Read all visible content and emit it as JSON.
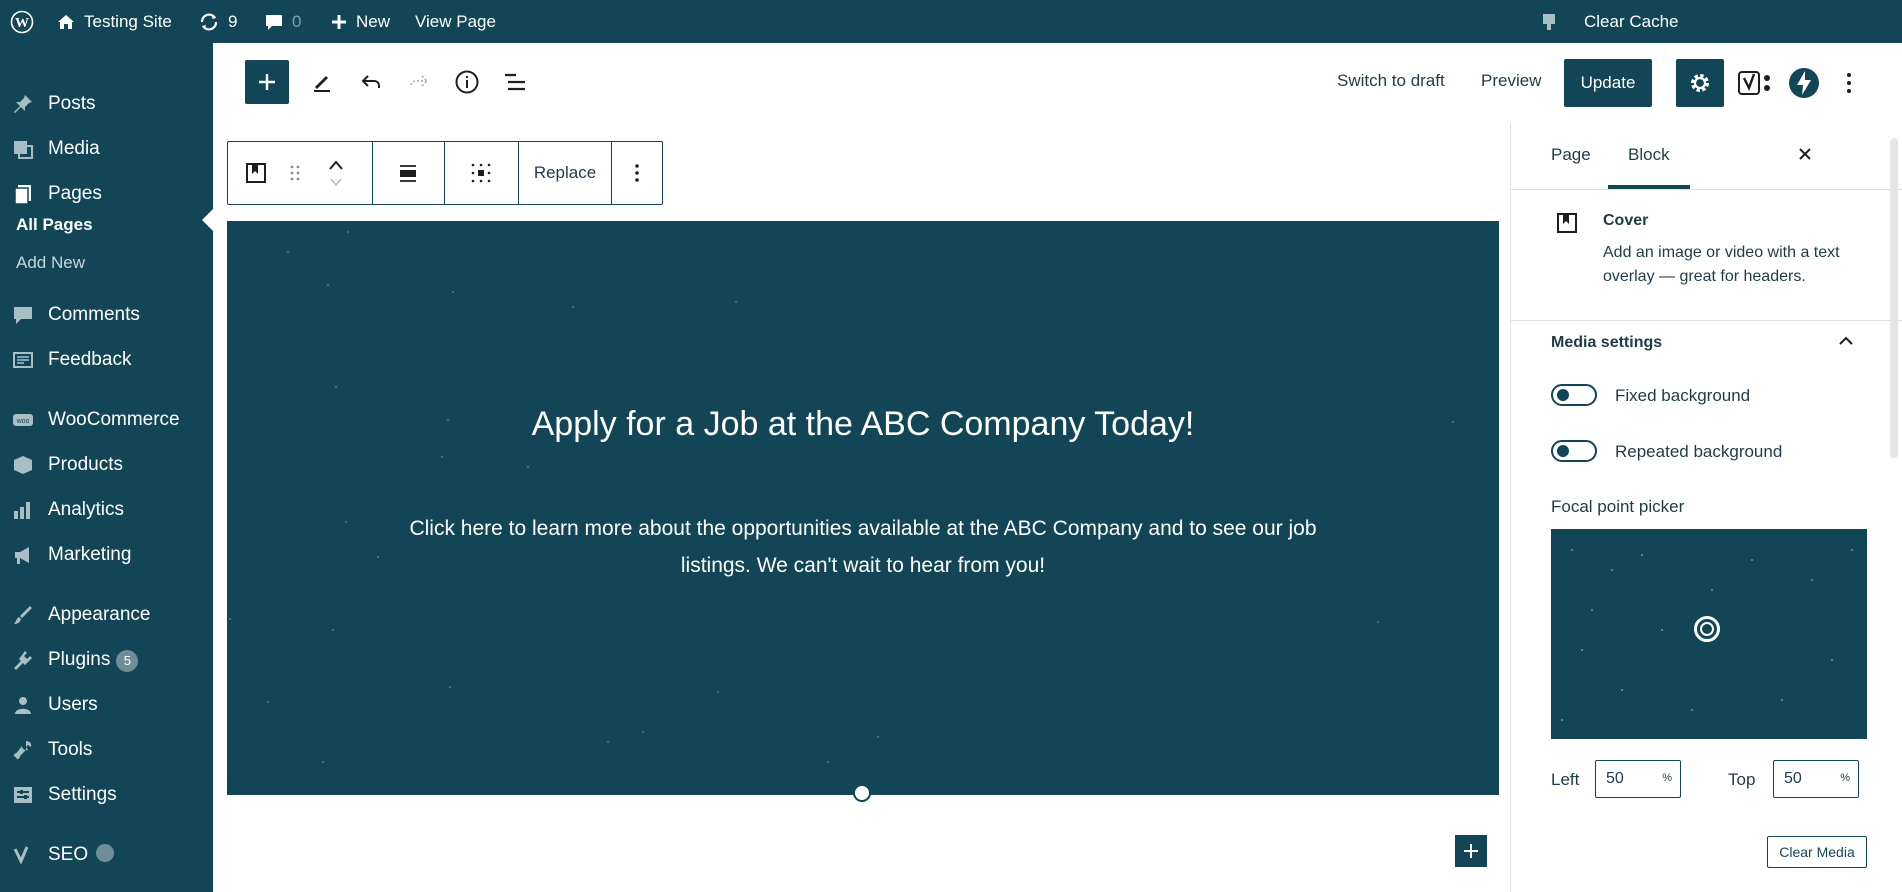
{
  "adminbar": {
    "site_name": "Testing Site",
    "updates_count": "9",
    "comments_count": "0",
    "new_label": "New",
    "view_page_label": "View Page",
    "clear_cache_label": "Clear Cache"
  },
  "menu": {
    "items": [
      {
        "label": "Posts",
        "icon": "pushpin-icon"
      },
      {
        "label": "Media",
        "icon": "media-icon"
      },
      {
        "label": "Pages",
        "icon": "pages-icon"
      },
      {
        "label": "Comments",
        "icon": "comment-icon"
      },
      {
        "label": "Feedback",
        "icon": "feedback-icon"
      },
      {
        "label": "WooCommerce",
        "icon": "woocommerce-icon"
      },
      {
        "label": "Products",
        "icon": "products-icon"
      },
      {
        "label": "Analytics",
        "icon": "analytics-icon"
      },
      {
        "label": "Marketing",
        "icon": "megaphone-icon"
      },
      {
        "label": "Appearance",
        "icon": "paintbrush-icon"
      },
      {
        "label": "Plugins",
        "icon": "plugin-icon",
        "badge": "5"
      },
      {
        "label": "Users",
        "icon": "users-icon"
      },
      {
        "label": "Tools",
        "icon": "wrench-icon"
      },
      {
        "label": "Settings",
        "icon": "settings-icon"
      },
      {
        "label": "SEO",
        "icon": "yoast-icon"
      }
    ],
    "submenu": {
      "all_pages": "All Pages",
      "add_new": "Add New"
    }
  },
  "header": {
    "switch_to_draft": "Switch to draft",
    "preview": "Preview",
    "update": "Update"
  },
  "toolbar": {
    "replace_label": "Replace"
  },
  "cover": {
    "title": "Apply for a Job at the ABC Company Today!",
    "text": "Click here to learn more about the opportunities available at the ABC Company and to see our job listings. We can't wait to hear from you!"
  },
  "sidebar": {
    "tab_page": "Page",
    "tab_block": "Block",
    "block_name": "Cover",
    "block_description": "Add an image or video with a text overlay — great for headers.",
    "media_settings_title": "Media settings",
    "fixed_background": "Fixed background",
    "repeated_background": "Repeated background",
    "focal_point_label": "Focal point picker",
    "left_label": "Left",
    "left_value": "50",
    "top_label": "Top",
    "top_value": "50",
    "unit": "%",
    "clear_media": "Clear Media"
  },
  "colors": {
    "brand": "#124555",
    "background": "#ffffff"
  }
}
